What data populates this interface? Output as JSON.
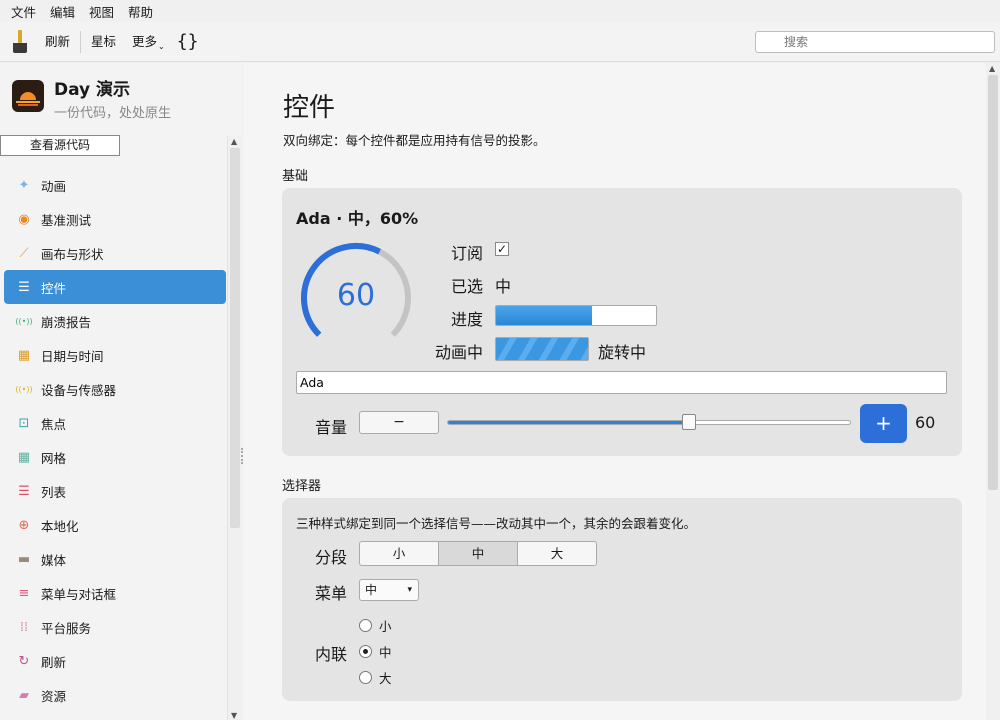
{
  "menu": [
    "文件",
    "编辑",
    "视图",
    "帮助"
  ],
  "toolbar": {
    "refresh": "刷新",
    "star": "星标",
    "more": "更多",
    "more_caret": "⌄",
    "braces": "{}",
    "search_placeholder": "搜索"
  },
  "app": {
    "title": "Day 演示",
    "subtitle": "一份代码，处处原生",
    "view_source": "查看源代码"
  },
  "nav": [
    {
      "label": "动画",
      "icon": "sparkle-icon",
      "glyph": "✦",
      "color": "#7ab3e8"
    },
    {
      "label": "基准测试",
      "icon": "speedometer-icon",
      "glyph": "◉",
      "color": "#f0861c"
    },
    {
      "label": "画布与形状",
      "icon": "brush-icon",
      "glyph": "⟋",
      "color": "#f0a030"
    },
    {
      "label": "控件",
      "icon": "controls-icon",
      "glyph": "☰",
      "color": "#4ab08a",
      "active": true
    },
    {
      "label": "崩溃报告",
      "icon": "broadcast-icon",
      "glyph": "((•))",
      "color": "#3fb07a"
    },
    {
      "label": "日期与时间",
      "icon": "calendar-icon",
      "glyph": "▦",
      "color": "#d99a2b"
    },
    {
      "label": "设备与传感器",
      "icon": "sensor-icon",
      "glyph": "((•))",
      "color": "#d9b22b"
    },
    {
      "label": "焦点",
      "icon": "focus-icon",
      "glyph": "⊡",
      "color": "#3aa7a0"
    },
    {
      "label": "网格",
      "icon": "grid-icon",
      "glyph": "▦",
      "color": "#5fb0a0"
    },
    {
      "label": "列表",
      "icon": "list-icon",
      "glyph": "☰",
      "color": "#e0506a"
    },
    {
      "label": "本地化",
      "icon": "globe-icon",
      "glyph": "⊕",
      "color": "#e06a50"
    },
    {
      "label": "媒体",
      "icon": "film-icon",
      "glyph": "▬",
      "color": "#9a8a7a"
    },
    {
      "label": "菜单与对话框",
      "icon": "menu-icon",
      "glyph": "≡",
      "color": "#e05a7a"
    },
    {
      "label": "平台服务",
      "icon": "dots-grid-icon",
      "glyph": "⁞⁞",
      "color": "#e08aa0"
    },
    {
      "label": "刷新",
      "icon": "refresh-icon",
      "glyph": "↻",
      "color": "#c0508a"
    },
    {
      "label": "资源",
      "icon": "folder-icon",
      "glyph": "▰",
      "color": "#d080b0"
    }
  ],
  "page": {
    "title": "控件",
    "description": "双向绑定：每个控件都是应用持有信号的投影。"
  },
  "basic": {
    "section": "基础",
    "card_title": "Ada · 中，60%",
    "gauge_value": "60",
    "gauge_fraction": 0.6,
    "subscribe_label": "订阅",
    "subscribe_checked": "✓",
    "selected_label": "已选",
    "selected_value": "中",
    "progress_label": "进度",
    "progress_fraction": 0.6,
    "animating_label": "动画中",
    "spinning_text": "旋转中",
    "name_value": "Ada",
    "volume_label": "音量",
    "minus": "−",
    "plus": "+",
    "volume_value": "60",
    "volume_fraction": 0.6
  },
  "picker": {
    "section": "选择器",
    "description": "三种样式绑定到同一个选择信号——改动其中一个，其余的会跟着变化。",
    "segment_label": "分段",
    "segments": [
      "小",
      "中",
      "大"
    ],
    "segment_selected": 1,
    "menu_label": "菜单",
    "menu_value": "中",
    "menu_caret": "▾",
    "inline_label": "内联",
    "options": [
      "小",
      "中",
      "大"
    ],
    "inline_selected": 1
  }
}
